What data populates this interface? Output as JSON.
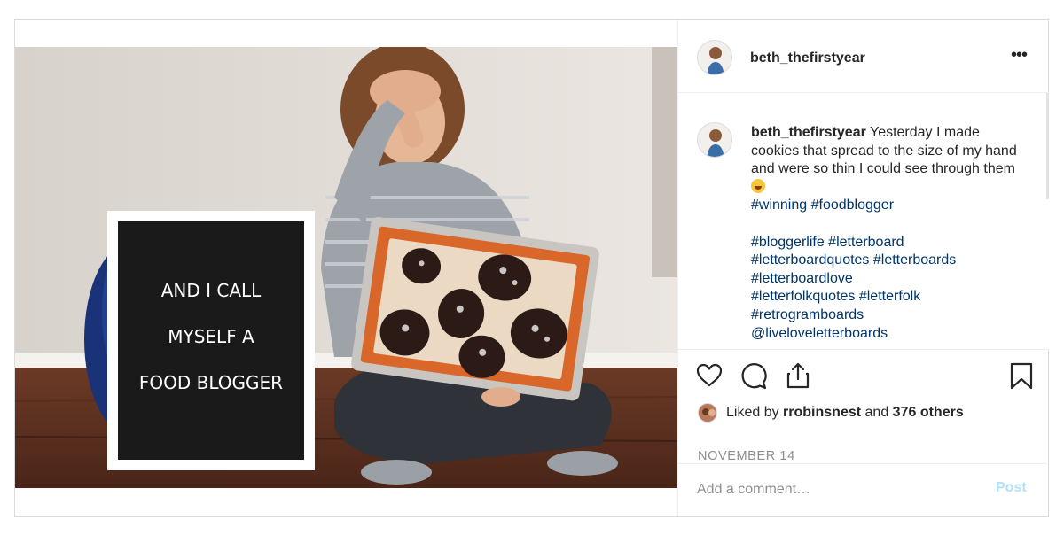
{
  "post": {
    "username": "beth_thefirstyear",
    "more_icon": "more-horizontal-icon",
    "caption": {
      "username": "beth_thefirstyear",
      "text": "Yesterday I made cookies that spread to the size of my hand and were so thin I could see through them",
      "emoji": "laughing-tears-emoji",
      "hashtags_line1": "#winning #foodblogger",
      "hashtag_lines": [
        "#bloggerlife #letterboard",
        "#letterboardquotes #letterboards",
        "#letterboardlove",
        "#letterfolkquotes #letterfolk",
        "#retrogramboards",
        "@liveloveletterboards"
      ]
    },
    "photo": {
      "letterboard_lines": [
        "AND I CALL",
        "MYSELF A",
        "FOOD BLOGGER"
      ]
    },
    "actions": {
      "like_icon": "heart-icon",
      "comment_icon": "comment-icon",
      "share_icon": "share-icon",
      "save_icon": "bookmark-icon"
    },
    "likes": {
      "prefix": "Liked by",
      "user": "rrobinsnest",
      "conjunction": "and",
      "others": "376 others"
    },
    "date": "NOVEMBER 14",
    "comment_box": {
      "placeholder": "Add a comment…",
      "post_label": "Post"
    },
    "colors": {
      "hashtag": "#003569",
      "post_button": "#b2dffc",
      "muted": "#8e8e8e"
    }
  }
}
